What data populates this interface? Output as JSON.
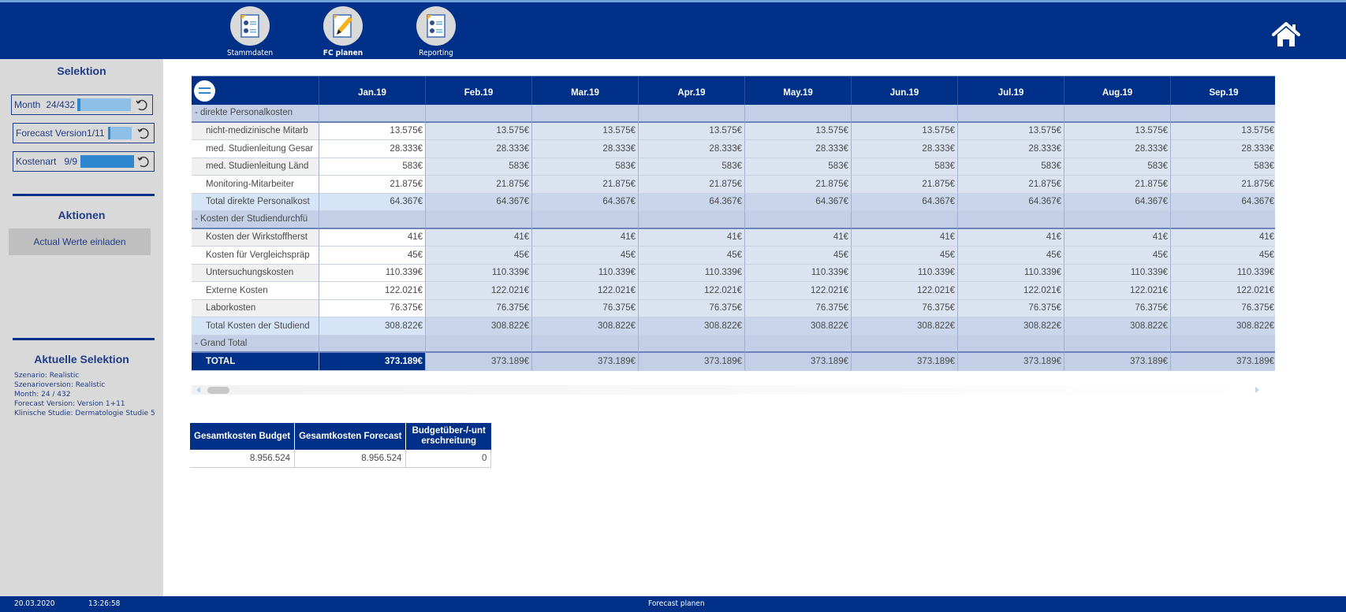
{
  "nav": {
    "items": [
      {
        "label": "Stammdaten",
        "icon": "report-document-icon",
        "active": false
      },
      {
        "label": "FC planen",
        "icon": "edit-document-icon",
        "active": true
      },
      {
        "label": "Reporting",
        "icon": "report-document-icon",
        "active": false
      }
    ],
    "home_icon": "home-icon"
  },
  "sidebar": {
    "selektion_title": "Selektion",
    "slicers": [
      {
        "label": "Month",
        "value": "24/432",
        "fill_fraction": 0.055
      },
      {
        "label": "Forecast Version",
        "value": "1/11",
        "fill_fraction": 0.09
      },
      {
        "label": "Kostenart",
        "value": "9/9",
        "fill_fraction": 1.0
      }
    ],
    "aktionen_title": "Aktionen",
    "action_button": "Actual Werte einladen",
    "aktuelle_title": "Aktuelle Selektion",
    "aktuelle_lines": [
      "Szenario: Realistic",
      "Szenarioversion: Realistic",
      "Month: 24 / 432",
      "Forecast Version: Version 1+11",
      "Klinische Studie: Dermatologie Studie 5"
    ]
  },
  "matrix": {
    "columns": [
      "Jan.19",
      "Feb.19",
      "Mar.19",
      "Apr.19",
      "May.19",
      "Jun.19",
      "Jul.19",
      "Aug.19",
      "Sep.19"
    ],
    "rows": [
      {
        "type": "group",
        "label": "-  direkte Personalkosten",
        "value": ""
      },
      {
        "type": "detail",
        "label": "nicht-medizinische Mitarb",
        "value": "13.575€"
      },
      {
        "type": "detail",
        "label": "med. Studienleitung Gesar",
        "value": "28.333€"
      },
      {
        "type": "detail",
        "label": "med. Studienleitung Länd",
        "value": "583€"
      },
      {
        "type": "detail",
        "label": "Monitoring-Mitarbeiter",
        "value": "21.875€"
      },
      {
        "type": "subtotal",
        "label": "Total direkte Personalkost",
        "value": "64.367€"
      },
      {
        "type": "group",
        "label": "-  Kosten der Studiendurchfü",
        "value": ""
      },
      {
        "type": "detail",
        "label": "Kosten der Wirkstoffherst",
        "value": "41€"
      },
      {
        "type": "detail",
        "label": "Kosten für Vergleichspräp",
        "value": "45€"
      },
      {
        "type": "detail",
        "label": "Untersuchungskosten",
        "value": "110.339€"
      },
      {
        "type": "detail",
        "label": "Externe Kosten",
        "value": "122.021€"
      },
      {
        "type": "detail",
        "label": "Laborkosten",
        "value": "76.375€"
      },
      {
        "type": "subtotal",
        "label": "Total Kosten der Studiend",
        "value": "308.822€"
      },
      {
        "type": "group",
        "label": "-  Grand Total",
        "value": ""
      },
      {
        "type": "total",
        "label": "TOTAL",
        "value": "373.189€"
      }
    ]
  },
  "kpi": {
    "headers": [
      "Gesamtkosten Budget",
      "Gesamtkosten Forecast",
      "Budgetüber-/-unt erschreitung"
    ],
    "values": [
      "8.956.524",
      "8.956.524",
      "0"
    ]
  },
  "footer": {
    "date": "20.03.2020",
    "time": "13:26:58",
    "page_title": "Forecast planen"
  }
}
